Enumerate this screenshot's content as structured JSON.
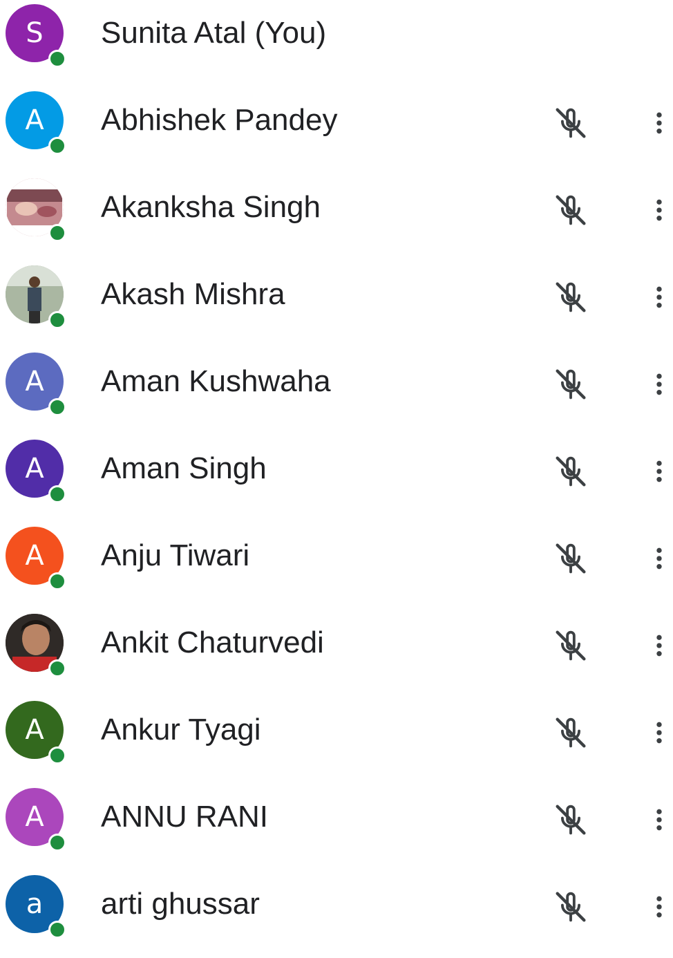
{
  "participants": [
    {
      "name": "Sunita Atal (You)",
      "initial": "S",
      "color": "#8e24aa",
      "avatar_type": "initial",
      "mic_control": false
    },
    {
      "name": "Abhishek Pandey",
      "initial": "A",
      "color": "#039be5",
      "avatar_type": "initial",
      "mic_control": true
    },
    {
      "name": "Akanksha Singh",
      "initial": "",
      "color": "#b86b74",
      "avatar_type": "photo",
      "mic_control": true
    },
    {
      "name": "Akash Mishra",
      "initial": "",
      "color": "#8a9a86",
      "avatar_type": "photo",
      "mic_control": true
    },
    {
      "name": "Aman Kushwaha",
      "initial": "A",
      "color": "#5c6bc0",
      "avatar_type": "initial",
      "mic_control": true
    },
    {
      "name": "Aman Singh",
      "initial": "A",
      "color": "#512da8",
      "avatar_type": "initial",
      "mic_control": true
    },
    {
      "name": "Anju Tiwari",
      "initial": "A",
      "color": "#f4511e",
      "avatar_type": "initial",
      "mic_control": true
    },
    {
      "name": "Ankit Chaturvedi",
      "initial": "",
      "color": "#3a2a24",
      "avatar_type": "photo",
      "mic_control": true
    },
    {
      "name": "Ankur Tyagi",
      "initial": "A",
      "color": "#33691e",
      "avatar_type": "initial",
      "mic_control": true
    },
    {
      "name": "ANNU RANI",
      "initial": "A",
      "color": "#ab47bc",
      "avatar_type": "initial",
      "mic_control": true
    },
    {
      "name": "arti ghussar",
      "initial": "a",
      "color": "#0d62a8",
      "avatar_type": "initial",
      "mic_control": true
    }
  ],
  "icons": {
    "mic": "mic-off-icon",
    "more": "more-vert-icon",
    "presence": "online-status-dot"
  },
  "colors": {
    "presence": "#1e8e3e",
    "icon": "#3c4043",
    "text": "#202124"
  }
}
